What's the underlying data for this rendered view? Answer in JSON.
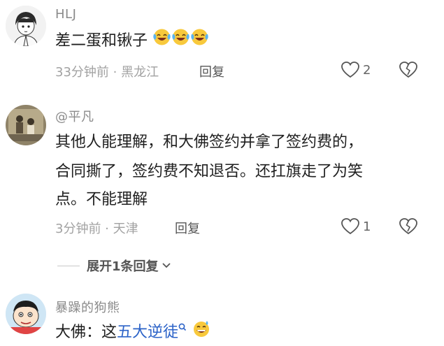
{
  "comments": [
    {
      "username": "HLJ",
      "text": "差二蛋和锹子",
      "emoji_count": 3,
      "emoji": "tears-of-joy-emoji",
      "meta": "33分钟前 · 黑龙江",
      "reply_label": "回复",
      "like_count": "2"
    },
    {
      "username": "@平凡",
      "lines": [
        "其他人能理解，和大佛签约并拿了签约费的，",
        "合同撕了，签约费不知退否。还扛旗走了为笑",
        "点。不能理解"
      ],
      "meta": "3分钟前 · 天津",
      "reply_label": "回复",
      "like_count": "1"
    },
    {
      "username": "暴躁的狗熊",
      "text_prefix": "大佛：这",
      "text_link": "五大逆徒",
      "emoji": "grinning-sweat-emoji"
    }
  ],
  "expand_label": "展开1条回复",
  "icons": {
    "like": "heart-outline-icon",
    "dislike": "broken-heart-icon",
    "search": "search-icon",
    "chevron": "chevron-down-icon"
  },
  "colors": {
    "link": "#2c63c8",
    "meta": "#a2a2a2",
    "username": "#8a8a8a"
  }
}
